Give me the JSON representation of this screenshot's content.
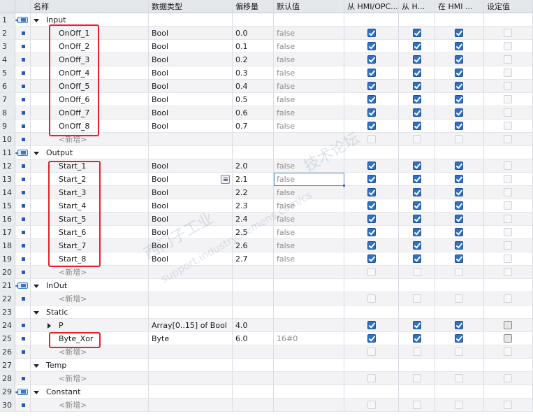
{
  "headers": {
    "name": "名称",
    "data_type": "数据类型",
    "offset": "偏移量",
    "default": "默认值",
    "hmi_opc": "从 HMI/OPC...",
    "hmi_visible": "从 H...",
    "hmi_in": "在 HMI ...",
    "setpoint": "设定值"
  },
  "rows": [
    {
      "n": "1",
      "kind": "section",
      "label": "Input"
    },
    {
      "n": "2",
      "kind": "item",
      "label": "OnOff_1",
      "type": "Bool",
      "offset": "0.0",
      "default": "false"
    },
    {
      "n": "3",
      "kind": "item",
      "label": "OnOff_2",
      "type": "Bool",
      "offset": "0.1",
      "default": "false"
    },
    {
      "n": "4",
      "kind": "item",
      "label": "OnOff_3",
      "type": "Bool",
      "offset": "0.2",
      "default": "false"
    },
    {
      "n": "5",
      "kind": "item",
      "label": "OnOff_4",
      "type": "Bool",
      "offset": "0.3",
      "default": "false"
    },
    {
      "n": "6",
      "kind": "item",
      "label": "OnOff_5",
      "type": "Bool",
      "offset": "0.4",
      "default": "false"
    },
    {
      "n": "7",
      "kind": "item",
      "label": "OnOff_6",
      "type": "Bool",
      "offset": "0.5",
      "default": "false"
    },
    {
      "n": "8",
      "kind": "item",
      "label": "OnOff_7",
      "type": "Bool",
      "offset": "0.6",
      "default": "false"
    },
    {
      "n": "9",
      "kind": "item",
      "label": "OnOff_8",
      "type": "Bool",
      "offset": "0.7",
      "default": "false"
    },
    {
      "n": "10",
      "kind": "add",
      "label": "<新增>"
    },
    {
      "n": "11",
      "kind": "section",
      "label": "Output"
    },
    {
      "n": "12",
      "kind": "item",
      "label": "Start_1",
      "type": "Bool",
      "offset": "2.0",
      "default": "false"
    },
    {
      "n": "13",
      "kind": "item",
      "label": "Start_2",
      "type": "Bool",
      "offset": "2.1",
      "default": "false"
    },
    {
      "n": "14",
      "kind": "item",
      "label": "Start_3",
      "type": "Bool",
      "offset": "2.2",
      "default": "false"
    },
    {
      "n": "15",
      "kind": "item",
      "label": "Start_4",
      "type": "Bool",
      "offset": "2.3",
      "default": "false"
    },
    {
      "n": "16",
      "kind": "item",
      "label": "Start_5",
      "type": "Bool",
      "offset": "2.4",
      "default": "false"
    },
    {
      "n": "17",
      "kind": "item",
      "label": "Start_6",
      "type": "Bool",
      "offset": "2.5",
      "default": "false"
    },
    {
      "n": "18",
      "kind": "item",
      "label": "Start_7",
      "type": "Bool",
      "offset": "2.6",
      "default": "false"
    },
    {
      "n": "19",
      "kind": "item",
      "label": "Start_8",
      "type": "Bool",
      "offset": "2.7",
      "default": "false"
    },
    {
      "n": "20",
      "kind": "add",
      "label": "<新增>"
    },
    {
      "n": "21",
      "kind": "section",
      "label": "InOut"
    },
    {
      "n": "22",
      "kind": "add",
      "label": "<新增>"
    },
    {
      "n": "23",
      "kind": "section",
      "label": "Static",
      "noPin": true
    },
    {
      "n": "24",
      "kind": "item",
      "label": "P",
      "type": "Array[0..15] of Bool",
      "offset": "4.0",
      "default": "",
      "expand": true,
      "setpoint": "grey"
    },
    {
      "n": "25",
      "kind": "item",
      "label": "Byte_Xor",
      "type": "Byte",
      "offset": "6.0",
      "default": "16#0",
      "setpoint": "grey"
    },
    {
      "n": "26",
      "kind": "add",
      "label": "<新增>"
    },
    {
      "n": "27",
      "kind": "section",
      "label": "Temp",
      "noPin": true
    },
    {
      "n": "28",
      "kind": "add",
      "label": "<新增>"
    },
    {
      "n": "29",
      "kind": "section",
      "label": "Constant"
    },
    {
      "n": "30",
      "kind": "add",
      "label": "<新增>"
    }
  ],
  "watermark": [
    "西门子工业",
    "support.industry.siemens.com/cs",
    "技术论坛"
  ]
}
